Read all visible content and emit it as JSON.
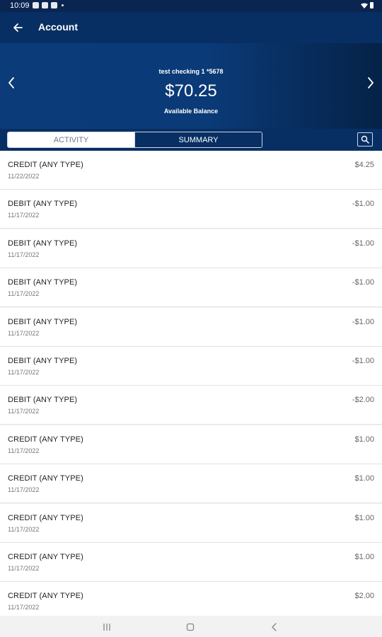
{
  "status_bar": {
    "time": "10:09"
  },
  "app_bar": {
    "title": "Account"
  },
  "account": {
    "name": "test checking 1 *5678",
    "balance": "$70.25",
    "balance_label": "Available Balance"
  },
  "tabs": [
    {
      "label": "ACTIVITY",
      "active": true
    },
    {
      "label": "SUMMARY",
      "active": false
    }
  ],
  "transactions": [
    {
      "type": "CREDIT (ANY TYPE)",
      "date": "11/22/2022",
      "amount": "$4.25"
    },
    {
      "type": "DEBIT (ANY TYPE)",
      "date": "11/17/2022",
      "amount": "-$1.00"
    },
    {
      "type": "DEBIT (ANY TYPE)",
      "date": "11/17/2022",
      "amount": "-$1.00"
    },
    {
      "type": "DEBIT (ANY TYPE)",
      "date": "11/17/2022",
      "amount": "-$1.00"
    },
    {
      "type": "DEBIT (ANY TYPE)",
      "date": "11/17/2022",
      "amount": "-$1.00"
    },
    {
      "type": "DEBIT (ANY TYPE)",
      "date": "11/17/2022",
      "amount": "-$1.00"
    },
    {
      "type": "DEBIT (ANY TYPE)",
      "date": "11/17/2022",
      "amount": "-$2.00"
    },
    {
      "type": "CREDIT (ANY TYPE)",
      "date": "11/17/2022",
      "amount": "$1.00"
    },
    {
      "type": "CREDIT (ANY TYPE)",
      "date": "11/17/2022",
      "amount": "$1.00"
    },
    {
      "type": "CREDIT (ANY TYPE)",
      "date": "11/17/2022",
      "amount": "$1.00"
    },
    {
      "type": "CREDIT (ANY TYPE)",
      "date": "11/17/2022",
      "amount": "$1.00"
    },
    {
      "type": "CREDIT (ANY TYPE)",
      "date": "11/17/2022",
      "amount": "$2.00"
    }
  ],
  "colors": {
    "header_dark": "#072f63",
    "hero_blue": "#0b3b78",
    "statusbar": "#0a2550"
  },
  "icons": {
    "back": "arrow-left-icon",
    "prev": "chevron-left-icon",
    "next": "chevron-right-icon",
    "search": "search-icon"
  }
}
